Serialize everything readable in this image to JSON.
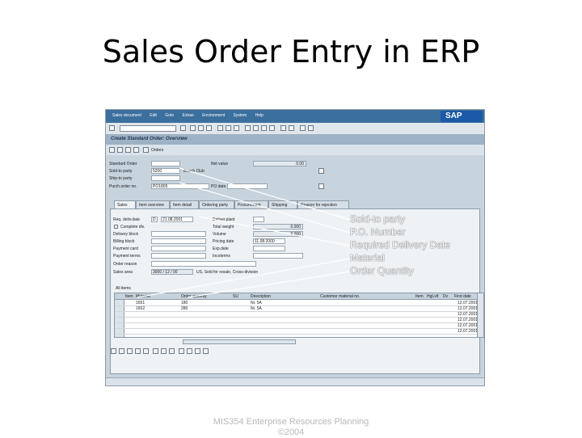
{
  "slide": {
    "title": "Sales Order Entry in ERP",
    "footer_line1": "MIS354 Enterprise Resources Planning",
    "footer_line2": "©2004"
  },
  "sap": {
    "menu": [
      "Sales document",
      "Edit",
      "Goto",
      "Extras",
      "Environment",
      "System",
      "Help"
    ],
    "logo": "SAP",
    "screen_title": "Create Standard Order: Overview",
    "orders_button": "Orders",
    "header_fields": {
      "standard_order_label": "Standard Order",
      "standard_order_value": "",
      "net_value_label": "Net value",
      "net_value_value": "0.00",
      "sold_to_label": "Sold-to party",
      "sold_to_value": "5200",
      "sold_to_desc": "Beach Club",
      "ship_to_label": "Ship-to party",
      "ship_to_value": "",
      "po_number_label": "Purch.order no.",
      "po_number_value": "PO1805",
      "po_date_label": "PO date",
      "po_date_value": ""
    },
    "tabs": [
      "Sales",
      "Item overview",
      "Item detail",
      "Ordering party",
      "Procurement",
      "Shipping",
      "Reason for rejection"
    ],
    "sales_tab": {
      "req_deliv_date_label": "Req. deliv.date",
      "req_deliv_date_prefix": "D",
      "req_deliv_date_value": "21.08.2001",
      "deliver_plant_label": "Deliver.plant",
      "total_weight_label": "Total weight",
      "total_weight_value": "0.000",
      "complete_dlv_label": "Complete dlv.",
      "delivery_block_label": "Delivery block",
      "volume_label": "Volume",
      "volume_value": "0.000",
      "billing_block_label": "Billing block",
      "pricing_date_label": "Pricing date",
      "pricing_date_value": "11.08.2000",
      "payment_card_label": "Payment card",
      "exp_date_label": "Exp.date",
      "payment_terms_label": "Payment terms",
      "incoterms_label": "Incoterms",
      "order_reason_label": "Order reason",
      "sales_area_label": "Sales area",
      "sales_area_value": "3000 / 12 / 00",
      "sales_area_desc": "US, Sold for resale, Cross-division"
    },
    "items_title": "All items",
    "item_columns": [
      "Item",
      "Material",
      "Order quantity",
      "SU",
      "Description",
      "Customer material no.",
      "Item",
      "HgLvIt",
      "Dv",
      "First date"
    ],
    "items": [
      {
        "item": "",
        "material": "1651",
        "qty": "180",
        "desc": "Nr. 5A",
        "date": "12.07.2001"
      },
      {
        "item": "",
        "material": "1652",
        "qty": "280",
        "desc": "Nr. 5A",
        "date": "12.07.2001"
      },
      {
        "item": "",
        "material": "",
        "qty": "",
        "desc": "",
        "date": "12.07.2001"
      },
      {
        "item": "",
        "material": "",
        "qty": "",
        "desc": "",
        "date": "12.07.2001"
      },
      {
        "item": "",
        "material": "",
        "qty": "",
        "desc": "",
        "date": "12.07.2001"
      },
      {
        "item": "",
        "material": "",
        "qty": "",
        "desc": "",
        "date": "12.07.2001"
      }
    ]
  },
  "annotations": [
    "Sold-to party",
    "P.O. Number",
    "Required Delivery Date",
    "Material",
    "Order Quantity"
  ],
  "colors": {
    "sap_menubar": "#3b6f9e",
    "sap_background": "#c7d4de",
    "annotation_text": "#ffffff"
  }
}
